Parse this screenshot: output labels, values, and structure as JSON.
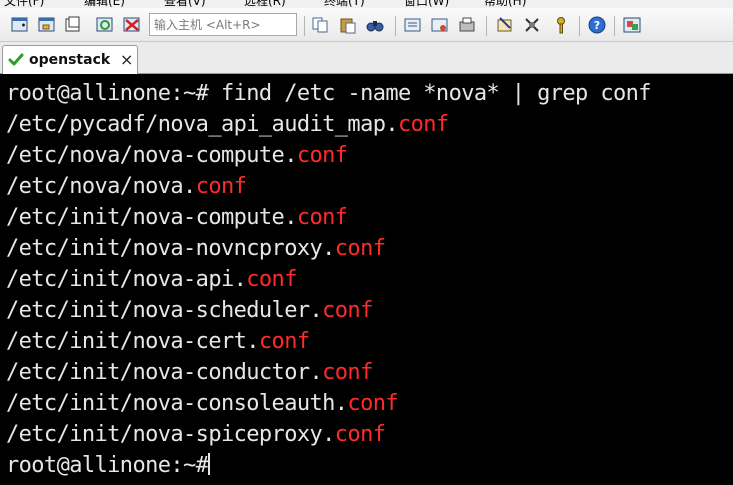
{
  "menubar": {
    "items": [
      "文件(F)",
      "编辑(E)",
      "查看(V)",
      "远程(R)",
      "终端(T)",
      "窗口(W)",
      "帮助(H)"
    ]
  },
  "toolbar": {
    "host_input_placeholder": "输入主机 <Alt+R>",
    "icons": [
      "new-session-icon",
      "open-session-icon",
      "reconnect-icon",
      "refresh-icon",
      "disconnect-icon",
      "copy-icon",
      "paste-icon",
      "find-icon",
      "print-icon",
      "print-setup-icon",
      "properties-icon",
      "options-icon",
      "key-icon",
      "help-icon",
      "screenshot-icon"
    ]
  },
  "tabs": [
    {
      "label": "openstack",
      "close": "×",
      "active": true
    }
  ],
  "terminal": {
    "text_color": "#e6e6e6",
    "highlight_color": "#ff2a2a",
    "lines": [
      {
        "pre": "root@allinone:~# find /etc -name *nova* | grep conf",
        "match": ""
      },
      {
        "pre": "/etc/pycadf/nova_api_audit_map.",
        "match": "conf"
      },
      {
        "pre": "/etc/nova/nova-compute.",
        "match": "conf"
      },
      {
        "pre": "/etc/nova/nova.",
        "match": "conf"
      },
      {
        "pre": "/etc/init/nova-compute.",
        "match": "conf"
      },
      {
        "pre": "/etc/init/nova-novncproxy.",
        "match": "conf"
      },
      {
        "pre": "/etc/init/nova-api.",
        "match": "conf"
      },
      {
        "pre": "/etc/init/nova-scheduler.",
        "match": "conf"
      },
      {
        "pre": "/etc/init/nova-cert.",
        "match": "conf"
      },
      {
        "pre": "/etc/init/nova-conductor.",
        "match": "conf"
      },
      {
        "pre": "/etc/init/nova-consoleauth.",
        "match": "conf"
      },
      {
        "pre": "/etc/init/nova-spiceproxy.",
        "match": "conf"
      },
      {
        "pre": "root@allinone:~#",
        "match": ""
      }
    ]
  }
}
